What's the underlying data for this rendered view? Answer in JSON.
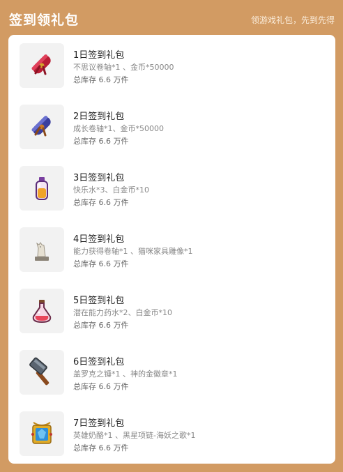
{
  "header": {
    "title": "签到领礼包",
    "subtitle": "领游戏礼包，先到先得"
  },
  "gifts": [
    {
      "title": "1日签到礼包",
      "desc": "不思议卷轴*1 、金币*50000",
      "stock": "总库存 6.6 万件",
      "icon": "red-scroll-icon"
    },
    {
      "title": "2日签到礼包",
      "desc": "成长卷轴*1、金币*50000",
      "stock": "总库存 6.6 万件",
      "icon": "blue-scroll-icon"
    },
    {
      "title": "3日签到礼包",
      "desc": "快乐水*3、白金币*10",
      "stock": "总库存 6.6 万件",
      "icon": "bottle-icon"
    },
    {
      "title": "4日签到礼包",
      "desc": "能力获得卷轴*1 、猫咪家具雕像*1",
      "stock": "总库存 6.6 万件",
      "icon": "cat-statue-icon"
    },
    {
      "title": "5日签到礼包",
      "desc": "潜在能力药水*2、白金币*10",
      "stock": "总库存 6.6 万件",
      "icon": "potion-flask-icon"
    },
    {
      "title": "6日签到礼包",
      "desc": "盖罗克之锤*1 、神的金徽章*1",
      "stock": "总库存 6.6 万件",
      "icon": "hammer-icon"
    },
    {
      "title": "7日签到礼包",
      "desc": "英雄奶酪*1 、黑星项链-海妖之歌*1",
      "stock": "总库存 6.6 万件",
      "icon": "necklace-icon"
    }
  ]
}
